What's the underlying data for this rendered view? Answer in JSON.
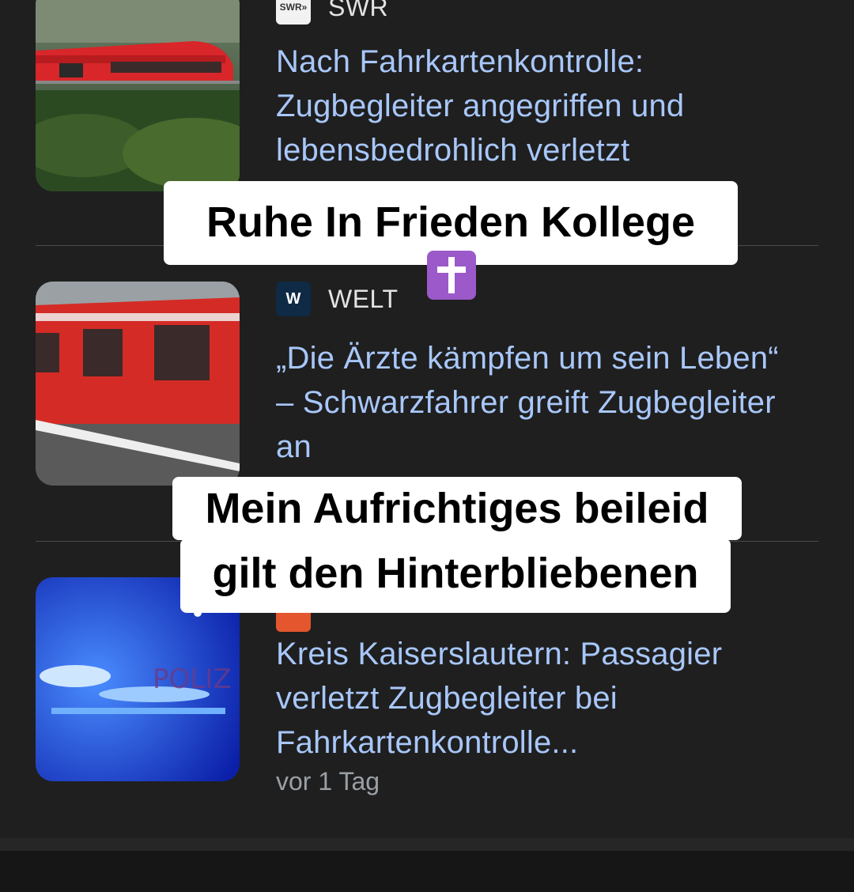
{
  "items": [
    {
      "source": "SWR",
      "headline": "Nach Fahrkartenkontrolle: Zugbegleiter angegriffen und lebensbedrohlich verletzt",
      "thumbnail": "red-train-in-forest"
    },
    {
      "source": "WELT",
      "logo_letter": "W",
      "headline": "„Die Ärzte kämpfen um sein Leben“ – Schwarzfahrer greift Zugbegleiter an",
      "thumbnail": "red-train-at-platform"
    },
    {
      "headline": "Kreis Kaiserslautern: Passagier verletzt Zugbegleiter bei Fahrkartenkontrolle...",
      "timestamp": "vor 1 Tag",
      "thumbnail": "police-car-blue-lights",
      "thumbnail_text": "POLIZ"
    }
  ],
  "captions": {
    "first": "Ruhe In Frieden Kollege",
    "first_emoji": "latin-cross-emoji",
    "second_line1": "Mein Aufrichtiges beileid",
    "second_line2": "gilt den Hinterbliebenen"
  },
  "colors": {
    "background": "#1f1f1f",
    "headline": "#a8c7fa",
    "source": "#e3e3e3",
    "timestamp": "#9aa0a6",
    "caption_bg": "#ffffff"
  }
}
